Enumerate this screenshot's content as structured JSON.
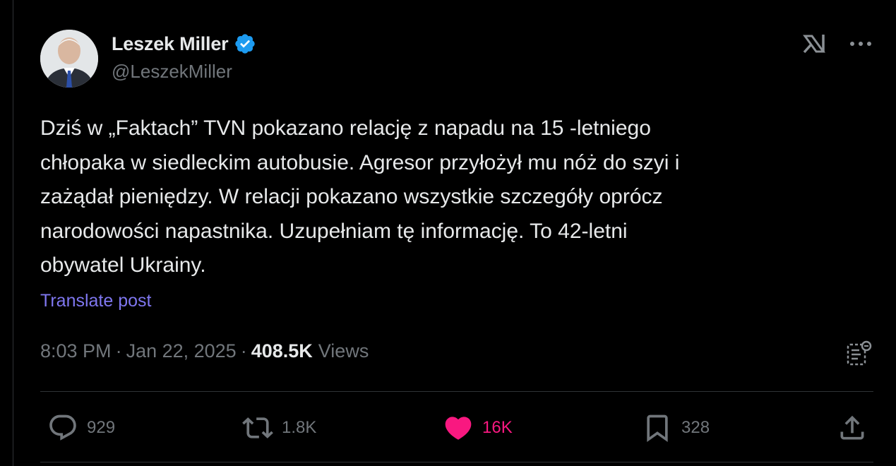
{
  "author": {
    "display_name": "Leszek Miller",
    "handle": "@LeszekMiller",
    "verified": true,
    "verified_color": "#1d9bf0",
    "avatar_icon": "profile-photo"
  },
  "top_actions": {
    "grok_icon": "grok-icon",
    "more_icon": "more-icon"
  },
  "post": {
    "text": "Dziś w „Faktach” TVN pokazano relację z napadu na 15 -letniego\nchłopaka w siedleckim autobusie. Agresor przyłożył mu nóż do szyi i\nzażądał pieniędzy. W relacji pokazano wszystkie szczegóły oprócz\nnarodowości napastnika. Uzupełniam tę informację. To 42-letni\nobywatel Ukrainy.",
    "translate_label": "Translate post",
    "time": "8:03 PM",
    "date": "Jan 22, 2025",
    "separator": "·",
    "views_count": "408.5K",
    "views_label": "Views"
  },
  "actions": {
    "replies": "929",
    "reposts": "1.8K",
    "likes": "16K",
    "bookmarks": "328"
  },
  "colors": {
    "background": "#000000",
    "text": "#e7e9ea",
    "secondary": "#71767b",
    "link": "#7f77f0",
    "like": "#f91880",
    "divider": "#2f3336"
  }
}
